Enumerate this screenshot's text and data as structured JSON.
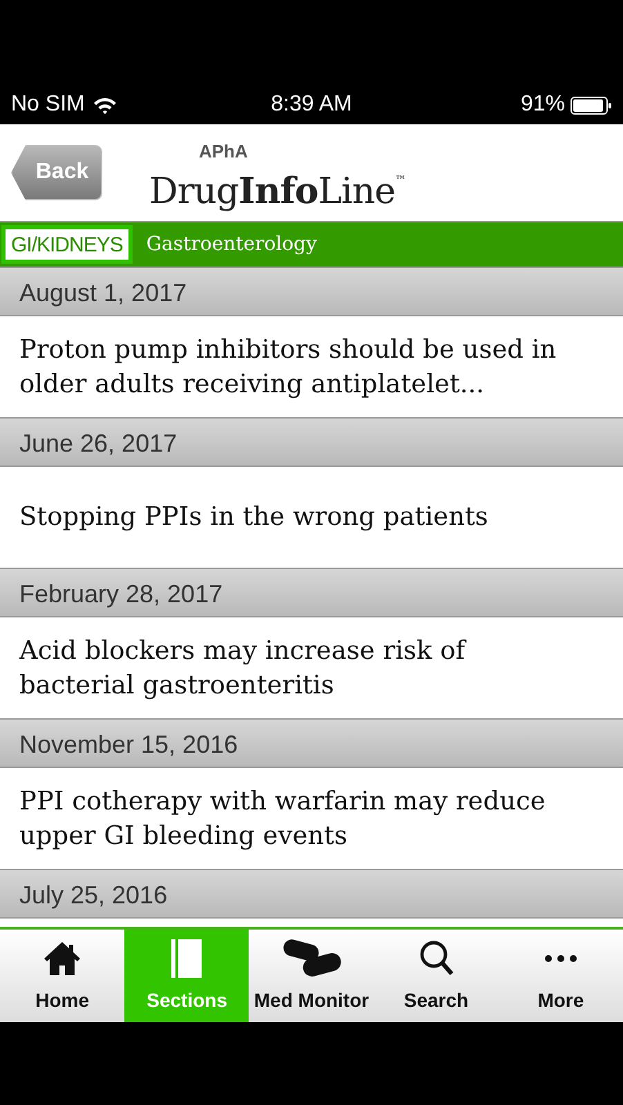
{
  "status_bar": {
    "carrier": "No SIM",
    "time": "8:39 AM",
    "battery": "91%"
  },
  "header": {
    "back": "Back",
    "logo_top": "APhA",
    "logo": "Drug**Info**Line$^{™}$"
  },
  "section_bar": {
    "badge": "GI/KIDNEYS",
    "title": "Gastroenterology"
  },
  "articles": [
    {
      "date": "August 1, 2017",
      "title": "Proton pump inhibitors should be used in older adults receiving antiplatelet..."
    },
    {
      "date": "June 26, 2017",
      "title": "Stopping PPIs in the wrong patients"
    },
    {
      "date": "February 28, 2017",
      "title": "Acid blockers may increase risk of bacterial gastroenteritis"
    },
    {
      "date": "November 15, 2016",
      "title": "PPI cotherapy with warfarin may reduce upper GI bleeding events"
    },
    {
      "date": "July 25, 2016"
    }
  ],
  "tabs": [
    {
      "label": "Home",
      "selected": false
    },
    {
      "label": "Sections",
      "selected": true
    },
    {
      "label": "Med Monitor",
      "selected": false
    },
    {
      "label": "Search",
      "selected": false
    },
    {
      "label": "More",
      "selected": false
    }
  ]
}
